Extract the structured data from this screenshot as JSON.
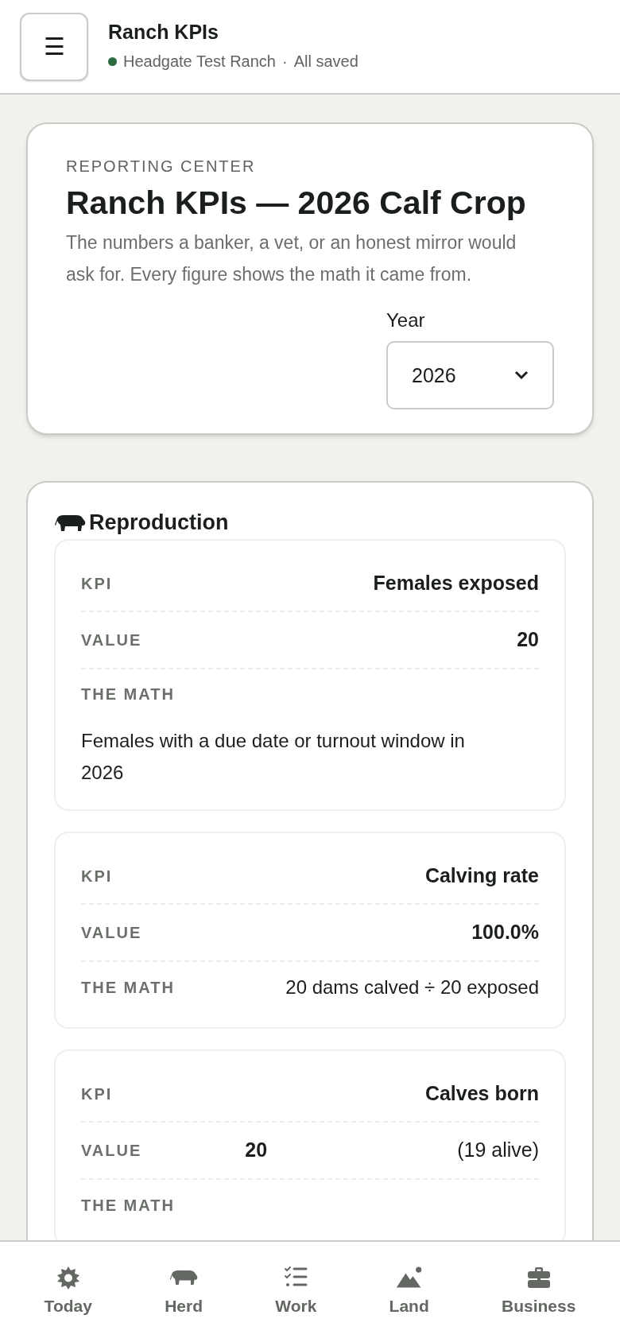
{
  "header": {
    "menu_icon": "☰",
    "title": "Ranch KPIs",
    "color": "#2e6b40",
    "ranch": "Headgate Test Ranch",
    "separator": "·",
    "save_status": "All saved"
  },
  "intro": {
    "eyebrow": "REPORTING CENTER",
    "title": "Ranch KPIs — 2026 Calf Crop",
    "description": "The numbers a banker, a vet, or an honest mirror would ask for. Every figure shows the math it came from.",
    "year_label": "Year",
    "year_value": "2026"
  },
  "section": {
    "title": "Reproduction",
    "kpis": [
      {
        "kpi_label": "KPI",
        "kpi": "Females exposed",
        "value_label": "VALUE",
        "value": "20",
        "math_label": "THE MATH",
        "math": "Females with a due date or turnout window in 2026",
        "kind": "below"
      },
      {
        "kpi_label": "KPI",
        "kpi": "Calving rate",
        "value_label": "VALUE",
        "value": "100.0%",
        "math_label": "THE MATH",
        "math": "20 dams calved ÷ 20 exposed",
        "kind": "inline"
      },
      {
        "kpi_label": "KPI",
        "kpi": "Calves born",
        "value_label": "VALUE",
        "value": "20",
        "value_note": "(19 alive)",
        "math_label": "THE MATH",
        "kind": "inline"
      }
    ]
  },
  "nav": [
    {
      "kind": "today",
      "label": "Today",
      "selected": false
    },
    {
      "kind": "herd",
      "label": "Herd",
      "selected": false
    },
    {
      "kind": "work",
      "label": "Work",
      "selected": false
    },
    {
      "kind": "land",
      "label": "Land",
      "selected": false
    },
    {
      "kind": "business",
      "label": "Business",
      "selected": false
    }
  ]
}
